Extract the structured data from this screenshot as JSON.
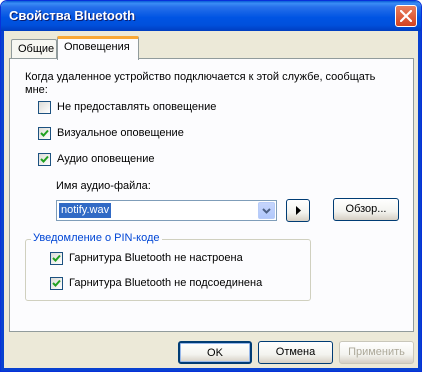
{
  "window": {
    "title": "Свойства Bluetooth"
  },
  "tabs": [
    {
      "label": "Общие",
      "selected": false
    },
    {
      "label": "Оповещения",
      "selected": true
    }
  ],
  "notifications": {
    "prompt": "Когда удаленное устройство подключается к этой службе, сообщать мне:",
    "options": [
      {
        "label": "Не предоставлять оповещение",
        "checked": false
      },
      {
        "label": "Визуальное оповещение",
        "checked": true
      },
      {
        "label": "Аудио оповещение",
        "checked": true
      }
    ],
    "audio_file_label": "Имя аудио-файла:",
    "audio_file_value": "notify.wav",
    "browse_label": "Обзор...",
    "play_icon": "play-icon"
  },
  "pin_group": {
    "title": "Уведомление о PIN-коде",
    "options": [
      {
        "label": "Гарнитура Bluetooth не настроена",
        "checked": true
      },
      {
        "label": "Гарнитура Bluetooth не подсоединена",
        "checked": true
      }
    ]
  },
  "footer": {
    "ok_label": "OK",
    "cancel_label": "Отмена",
    "apply_label": "Применить",
    "apply_enabled": false
  },
  "colors": {
    "titlebar": "#0054e3",
    "accent_tab": "#f9a835",
    "group_title": "#0046d5",
    "selection": "#316ac5"
  }
}
